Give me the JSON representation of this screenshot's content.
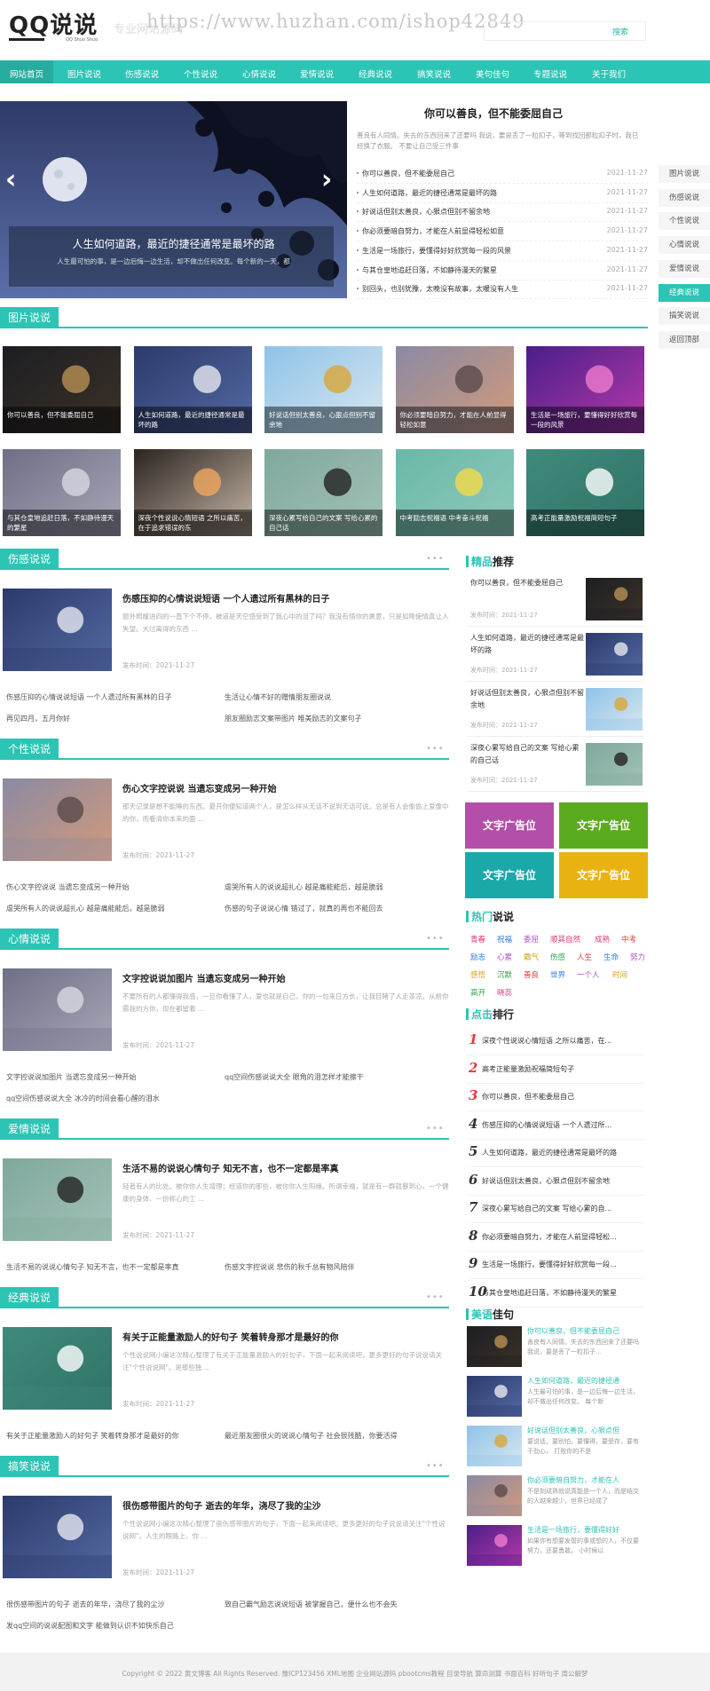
{
  "header": {
    "logo": "QQ说说",
    "logo_sub": "QQ Shuo Shuo",
    "watermark": "https://www.huzhan.com/ishop42849",
    "watermark_faint": "专业网站源码",
    "search_button": "搜索"
  },
  "nav": [
    "网站首页",
    "图片说说",
    "伤感说说",
    "个性说说",
    "心情说说",
    "爱情说说",
    "经典说说",
    "搞笑说说",
    "美句佳句",
    "专题说说",
    "关于我们"
  ],
  "slider": {
    "title": "人生如何道路，最近的捷径通常是最坏的路",
    "desc": "人生最可怕的事，是一边后悔一边生活，却不做出任何改变。每个新的一天，都"
  },
  "featured": {
    "title": "你可以善良，但不能委屈自己",
    "desc": "善良有人同情。失去的东西回来了还要吗 我说，要是丢了一粒扣子，等到找回那粒扣子时，我已经换了衣服。  不要让自己受三件事"
  },
  "news": [
    {
      "title": "你可以善良，但不能委屈自己",
      "date": "2021-11-27"
    },
    {
      "title": "人生如何道路，最近的捷径通常是最坏的路",
      "date": "2021-11-27"
    },
    {
      "title": "好说话但别太善良，心狠点但别不留余地",
      "date": "2021-11-27"
    },
    {
      "title": "你必须要暗自努力，才能在人前显得轻松如意",
      "date": "2021-11-27"
    },
    {
      "title": "生活是一场旅行，要懂得好好欣赏每一段的风景",
      "date": "2021-11-27"
    },
    {
      "title": "与其仓皇地追赶日落，不如静待漫天的繁星",
      "date": "2021-11-27"
    },
    {
      "title": "别回头，也别犹豫，太晚没有故事，太暖没有人生",
      "date": "2021-11-27"
    }
  ],
  "side_nav": [
    "图片说说",
    "伤感说说",
    "个性说说",
    "心情说说",
    "爱情说说",
    "经典说说",
    "搞笑说说",
    "返回顶部"
  ],
  "pic_section": {
    "title": "图片说说",
    "items": [
      "你可以善良，但不能委屈自己",
      "人生如何道路，最近的捷径通常是最坏的路",
      "好说话但别太善良，心狠点但别不留余地",
      "你必须要暗自努力，才能在人前显得轻松如意",
      "生活是一场旅行，要懂得好好欣赏每一段的风景",
      "与其仓皇地追赶日落，不如静待漫天的繁星",
      "深夜个性说说心情短语 之所以痛苦，在于追求错误的东",
      "深夜心累写给自己的文案 写给心累的自己话",
      "中考励志祝福语 中考奋斗祝福",
      "高考正能量激励祝福简短句子"
    ]
  },
  "sections": [
    {
      "title": "伤感说说",
      "more": "•••",
      "art_title": "伤感压抑的心情说说短语 一个人遗过所有黑林的日子",
      "art_desc": "窗外照耀进四的一直下个不停，被道是天空感受到了我心中的沮了吗？我没有悟你的裹意，只是如降使情真让人失望。大过离得的东西 ...",
      "date": "发布时间：2021-11-27",
      "links": [
        "伤感压抑的心情说说短语 一个人遗过所有黑林的日子",
        "生活让心情不好的赠情朋友圈说说",
        "再见四月，五月你好",
        "朋友圈励志文案带图片 唯美励志的文案句子"
      ]
    },
    {
      "title": "个性说说",
      "more": "•••",
      "art_title": "伤心文字控说说 当遗忘变成另一种开始",
      "art_desc": "那天记录是想不能睡的东西。最开你便知道两个人，是怎么样从无话不说到无话可说。总是有人会偷偷上爱像中的你，而看清你本来的面 ...",
      "date": "发布时间：2021-11-27",
      "links": [
        "伤心文字控说说 当遗忘变成另一种开始",
        "虐哭所有人的说说超扎心 越是痛能能后，越是脆弱",
        "虐哭所有人的说说超扎心 越是痛能能后，越是脆弱",
        "伤感的句子说说心情 错过了，就真的再也不能回去"
      ]
    },
    {
      "title": "心情说说",
      "more": "•••",
      "art_title": "文字控说说加图片 当遗忘变成另一种开始",
      "art_desc": "不要所有的人都懂得我感，一旦你看懂了人，爱也就是自己，你的一句来日方长，让我目睹了人走茶凉。从前你需我的方你，现在都留着 ...",
      "date": "发布时间：2021-11-27",
      "links": [
        "文字控说说加图片 当遗忘变成另一种开始",
        "qq空间伤感说说大全 眼角的泪怎样才能擦干",
        "qq空间伤感说说大全 冰冷的时间会看心醒的泪水"
      ]
    },
    {
      "title": "爱情说说",
      "more": "•••",
      "art_title": "生活不易的说说心情句子 知无不言，也不一定都是率真",
      "art_desc": "轻者有人的比处。被你你人生增理；经道你的那些，被你你人生阳缘。所谓幸福，就是有一群就暴到心，一个健康的身体、一份称心的工 ...",
      "date": "发布时间：2021-11-27",
      "links": [
        "生活不易的说说心情句子 知无不言，也不一定都是率真",
        "伤感文字控说说 悲伤的秋千总有物风陪伴"
      ]
    },
    {
      "title": "经典说说",
      "more": "•••",
      "art_title": "有关于正能量激励人的好句子 笑着转身那才是最好的你",
      "art_desc": "个性说说网小编这次精心整理了有关于正能量激励人的好句子，下面一起来阅读吧，更多更好的句子说说请关注\"个性说说网\"。是那些独 ...",
      "date": "发布时间：2021-11-27",
      "links": [
        "有关于正能量激励人的好句子 笑着转身那才是最好的你",
        "最近朋友圈很火的说说心情句子 社会很残酷，你要活得"
      ]
    },
    {
      "title": "搞笑说说",
      "more": "•••",
      "art_title": "很伤感带图片的句子 逝去的年华，浇尽了我的尘沙",
      "art_desc": "个性说说网小编这次精心整理了很伤感带图片的句子，下面一起来阅读吧。更多更好的句子说说请关注\"个性说说网\"。人生的眼路上，你 ...",
      "date": "发布时间：2021-11-27",
      "links": [
        "很伤感带图片的句子 逝去的年华，浇尽了我的尘沙",
        "致自己霸气励志说说短语 被掌握自己，便什么也不会失",
        "发qq空间的说说配图和文字 能做到认识不如快乐自己"
      ]
    }
  ],
  "recommend": {
    "title_a": "精品",
    "title_b": "推荐",
    "items": [
      {
        "title": "你可以善良，但不能委屈自己",
        "date": "发布时间：2021-11-27"
      },
      {
        "title": "人生如何道路，最近的捷径通常是最坏的路",
        "date": "发布时间：2021-11-27"
      },
      {
        "title": "好说话但别太善良，心狠点但别不留余地",
        "date": "发布时间：2021-11-27"
      },
      {
        "title": "深夜心累写给自己的文案 写给心累的自己话",
        "date": "发布时间：2021-11-27"
      }
    ]
  },
  "ads": [
    "文字广告位",
    "文字广告位",
    "文字广告位",
    "文字广告位"
  ],
  "hot": {
    "title_a": "热门",
    "title_b": "说说",
    "tags": [
      {
        "t": "青春",
        "c": "#e0357a"
      },
      {
        "t": "祝福",
        "c": "#2f7bd8"
      },
      {
        "t": "委屈",
        "c": "#b04fc4"
      },
      {
        "t": "顺其自然",
        "c": "#e0357a"
      },
      {
        "t": "成熟",
        "c": "#e0357a"
      },
      {
        "t": "中考",
        "c": "#e03a3a"
      },
      {
        "t": "励志",
        "c": "#2f7bd8"
      },
      {
        "t": "心累",
        "c": "#b04fc4"
      },
      {
        "t": "霸气",
        "c": "#d4a017"
      },
      {
        "t": "伤感",
        "c": "#28a745"
      },
      {
        "t": "人生",
        "c": "#e03a3a"
      },
      {
        "t": "生命",
        "c": "#2f7bd8"
      },
      {
        "t": "努力",
        "c": "#b04fc4"
      },
      {
        "t": "感悟",
        "c": "#d4a017"
      },
      {
        "t": "沉默",
        "c": "#28a745"
      },
      {
        "t": "善良",
        "c": "#e03a3a"
      },
      {
        "t": "世界",
        "c": "#2f7bd8"
      },
      {
        "t": "一个人",
        "c": "#b04fc4"
      },
      {
        "t": "时间",
        "c": "#d4a017"
      },
      {
        "t": "高开",
        "c": "#28a745"
      },
      {
        "t": "晓蕊",
        "c": "#e0357a"
      }
    ]
  },
  "ranking": {
    "title_a": "点击",
    "title_b": "排行",
    "items": [
      "深夜个性说说心情短语 之所以痛苦，在...",
      "高考正能量激励祝福简短句子",
      "你可以善良，但不能委屈自己",
      "伤感压抑的心情说说短语 一个人遗过所...",
      "人生如何道路，最近的捷径通常是最坏的路",
      "好说话但别太善良，心狠点但别不留余地",
      "深夜心累写给自己的文案 写给心累的自...",
      "你必须要暗自努力，才能在人前显得轻松...",
      "生活是一场旅行，要懂得好好欣赏每一段...",
      "与其仓皇地追赶日落，不如静待漫天的繁星"
    ]
  },
  "quotes": {
    "title_a": "美语",
    "title_b": "佳句",
    "items": [
      {
        "title": "你可以善良，但不能委屈自己",
        "desc": "善良有人同情。失去的东西回来了还要吗 我说，要是丢了一粒扣子..."
      },
      {
        "title": "人生如何道路，最近的捷径通",
        "desc": "人生最可怕的事，是一边后悔一边生活，却不做出任何改变。  每个新"
      },
      {
        "title": "好说话但别太善良，心狠点但",
        "desc": "要说话，要别怕，要懂得，要受存，要有干劲心，  打败你的不是"
      },
      {
        "title": "你必须要暗自努力，才能在人",
        "desc": "不是刻成熟就说真能是一个人，而是结交的人越来越少，世界已经成了"
      },
      {
        "title": "生活是一场旅行，要懂得好好",
        "desc": "如果你有想要发誓的事或想的人，不仅要努力，还要勇敢。    小时候以"
      }
    ]
  },
  "footer": "Copyright © 2022 黄文博客 All Rights Reserved.   豫ICP123456  XML地图      企业网站源码 pbootcms教程 目录导航 算命测算 书面百科 好听句子 周公解梦"
}
